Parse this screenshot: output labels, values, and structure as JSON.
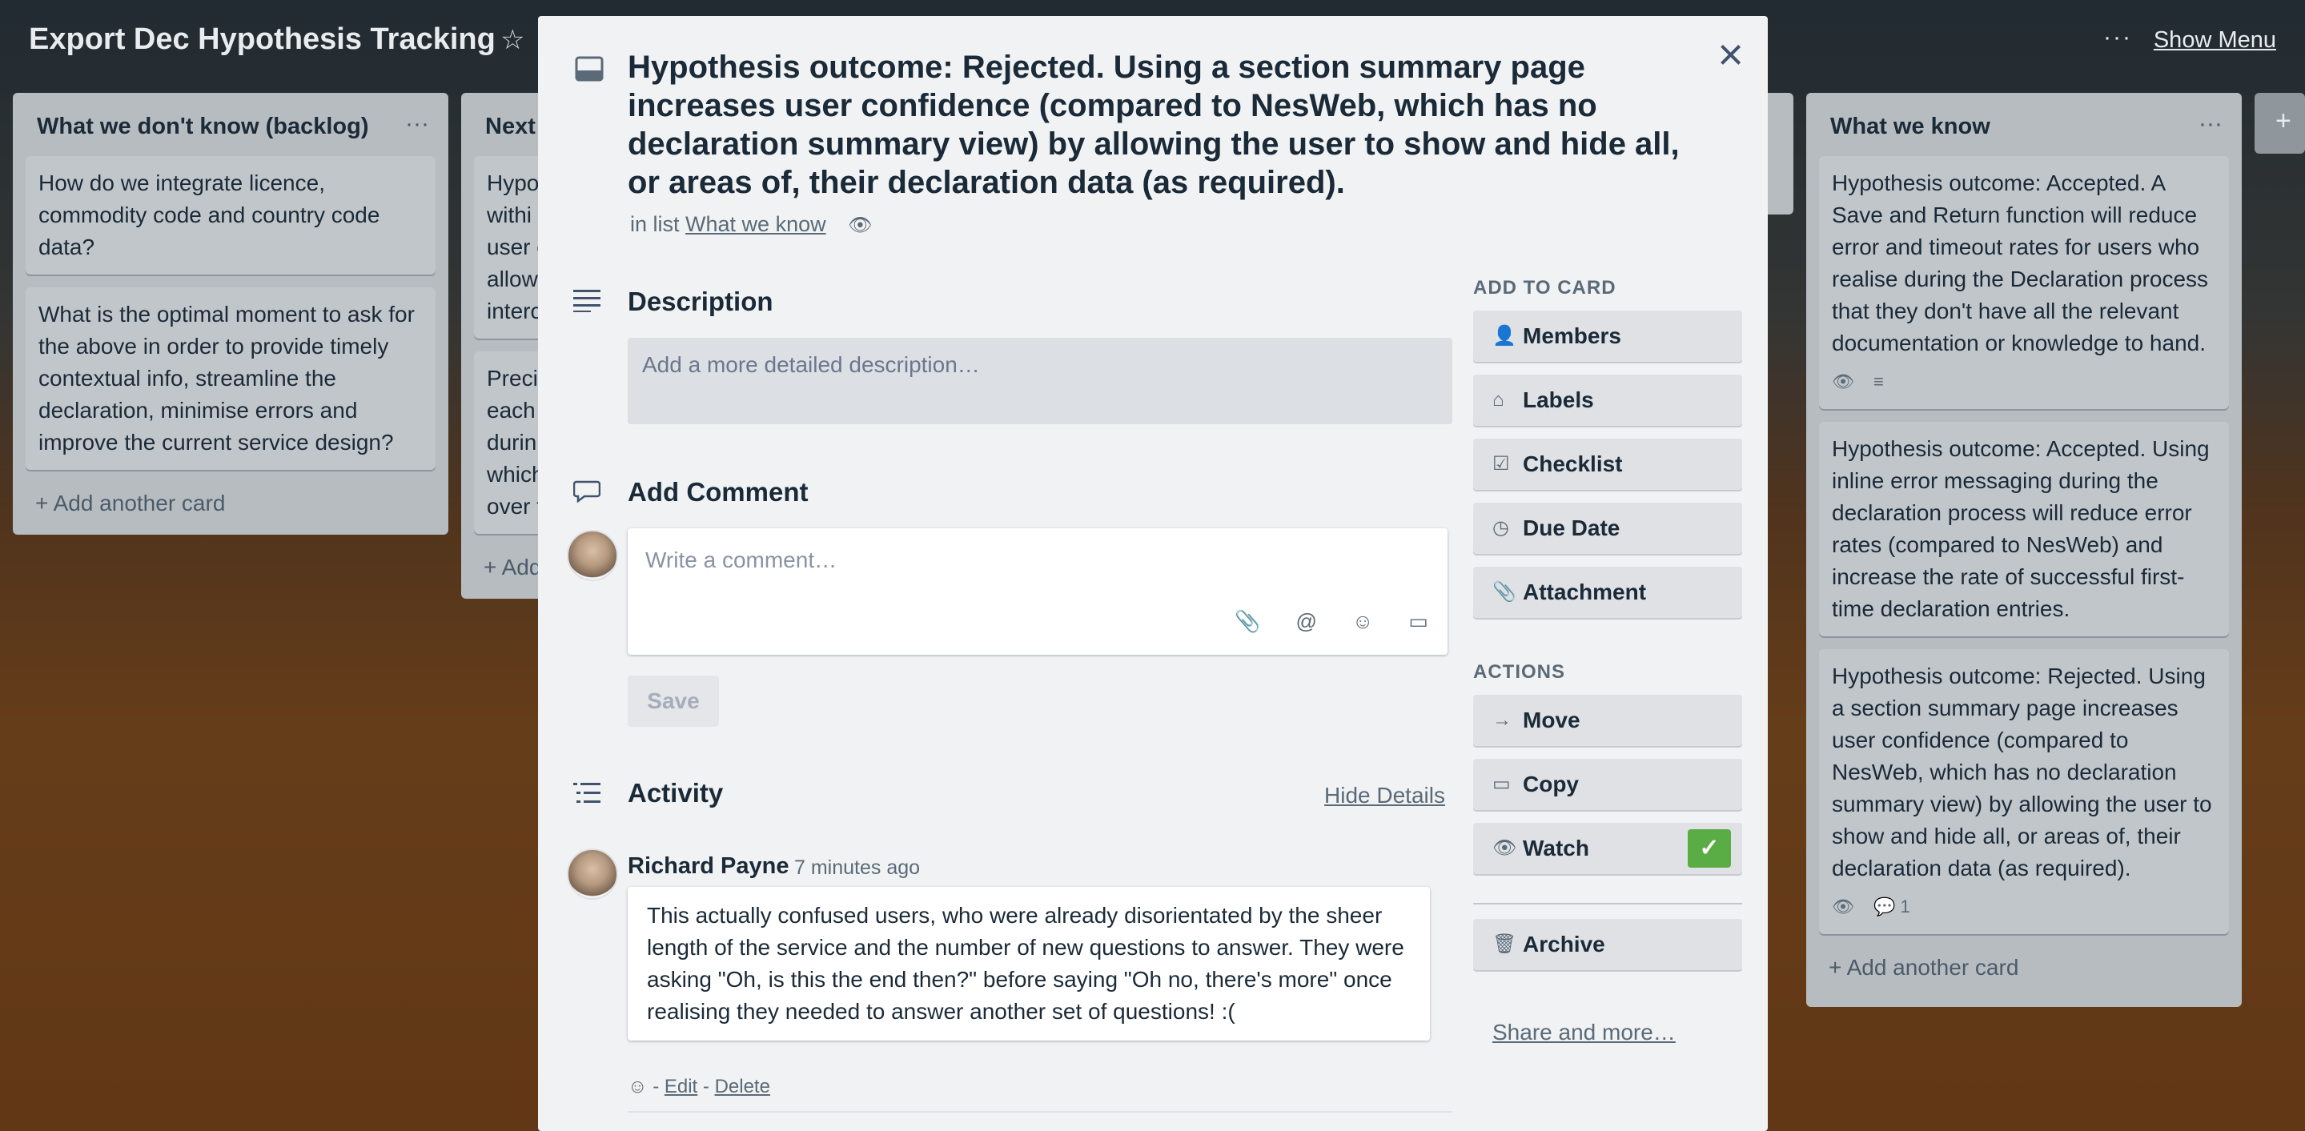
{
  "board": {
    "title": "Export Dec Hypothesis Tracking",
    "star_icon": "star-icon",
    "menu_dots": "···",
    "show_menu": "Show Menu",
    "add_list_plus": "+"
  },
  "lists": [
    {
      "title": "What we don't know (backlog)",
      "menu": "···",
      "cards": [
        {
          "text": "How do we integrate licence, commodity code and country code data?"
        },
        {
          "text": "What is the optimal moment to ask for the above in order to provide timely contextual info, streamline the declaration, minimise errors and improve the current service design?"
        }
      ],
      "add_card": "+ Add another card"
    },
    {
      "title": "Next",
      "cards": [
        {
          "lines": [
            "Hypo",
            "withi",
            "user c",
            "allow",
            "interc"
          ]
        },
        {
          "lines": [
            "Preci",
            "each",
            "durin",
            "which",
            "over t"
          ]
        }
      ],
      "add_card": "+ Add"
    },
    {
      "title": "What we know",
      "menu": "···",
      "cards": [
        {
          "text": "Hypothesis outcome: Accepted. A Save and Return function will reduce error and timeout rates for users who realise during the Declaration process that they don't have all the relevant documentation or knowledge to hand.",
          "badges": [
            "eye-icon",
            "description-icon"
          ]
        },
        {
          "text": "Hypothesis outcome: Accepted. Using inline error messaging during the declaration process will reduce error rates (compared to NesWeb) and increase the rate of successful first-time declaration entries."
        },
        {
          "text": "Hypothesis outcome: Rejected. Using a section summary page increases user confidence (compared to NesWeb, which has no declaration summary view) by allowing the user to show and hide all, or areas of, their declaration data (as required).",
          "badges": [
            "eye-icon",
            "comment-icon"
          ],
          "comment_count": "1"
        }
      ],
      "add_card": "+ Add another card"
    }
  ],
  "modal": {
    "close": "×",
    "title": "Hypothesis outcome: Rejected. Using a section summary page increases user confidence (compared to NesWeb, which has no declaration summary view) by allowing the user to show and hide all, or areas of, their declaration data (as required).",
    "in_list_prefix": "in list",
    "in_list_link": "What we know",
    "description_title": "Description",
    "description_placeholder": "Add a more detailed description…",
    "add_comment_title": "Add Comment",
    "comment_placeholder": "Write a comment…",
    "save_label": "Save",
    "activity_title": "Activity",
    "hide_details": "Hide Details",
    "activity": {
      "author": "Richard Payne",
      "time": "7 minutes ago",
      "comment": "This actually confused users, who were already disorientated by the sheer length of the service and the number of new questions to answer. They were asking \"Oh, is this the end then?\" before saying \"Oh no, there's more\" once realising they needed to answer another set of questions! :(",
      "sep1": "-",
      "edit": "Edit",
      "sep2": "-",
      "delete": "Delete"
    }
  },
  "sidebar": {
    "add_to_card_heading": "ADD TO CARD",
    "add_to_card": [
      {
        "label": "Members",
        "icon": "person-icon"
      },
      {
        "label": "Labels",
        "icon": "tag-icon"
      },
      {
        "label": "Checklist",
        "icon": "checklist-icon"
      },
      {
        "label": "Due Date",
        "icon": "clock-icon"
      },
      {
        "label": "Attachment",
        "icon": "paperclip-icon"
      }
    ],
    "actions_heading": "ACTIONS",
    "actions": [
      {
        "label": "Move",
        "icon": "arrow-right-icon"
      },
      {
        "label": "Copy",
        "icon": "card-icon"
      },
      {
        "label": "Watch",
        "icon": "eye-icon"
      },
      {
        "label": "Archive",
        "icon": "archive-icon"
      }
    ],
    "share_more": "Share and more…"
  },
  "colors": {
    "watch_active": "#5aac44",
    "text_primary": "#1b2a38",
    "modal_bg": "#f0f2f3"
  }
}
